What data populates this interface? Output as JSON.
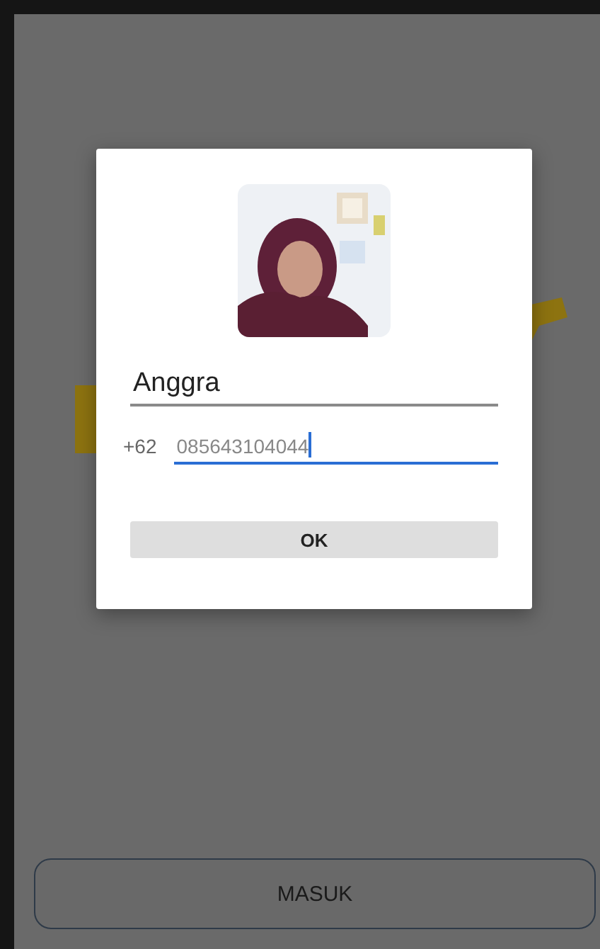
{
  "dialog": {
    "name_field": {
      "value": "Anggra",
      "focused": false
    },
    "phone_field": {
      "prefix": "+62",
      "value": "085643104044",
      "focused": true
    },
    "ok_button": "OK"
  },
  "login_button": "MASUK"
}
